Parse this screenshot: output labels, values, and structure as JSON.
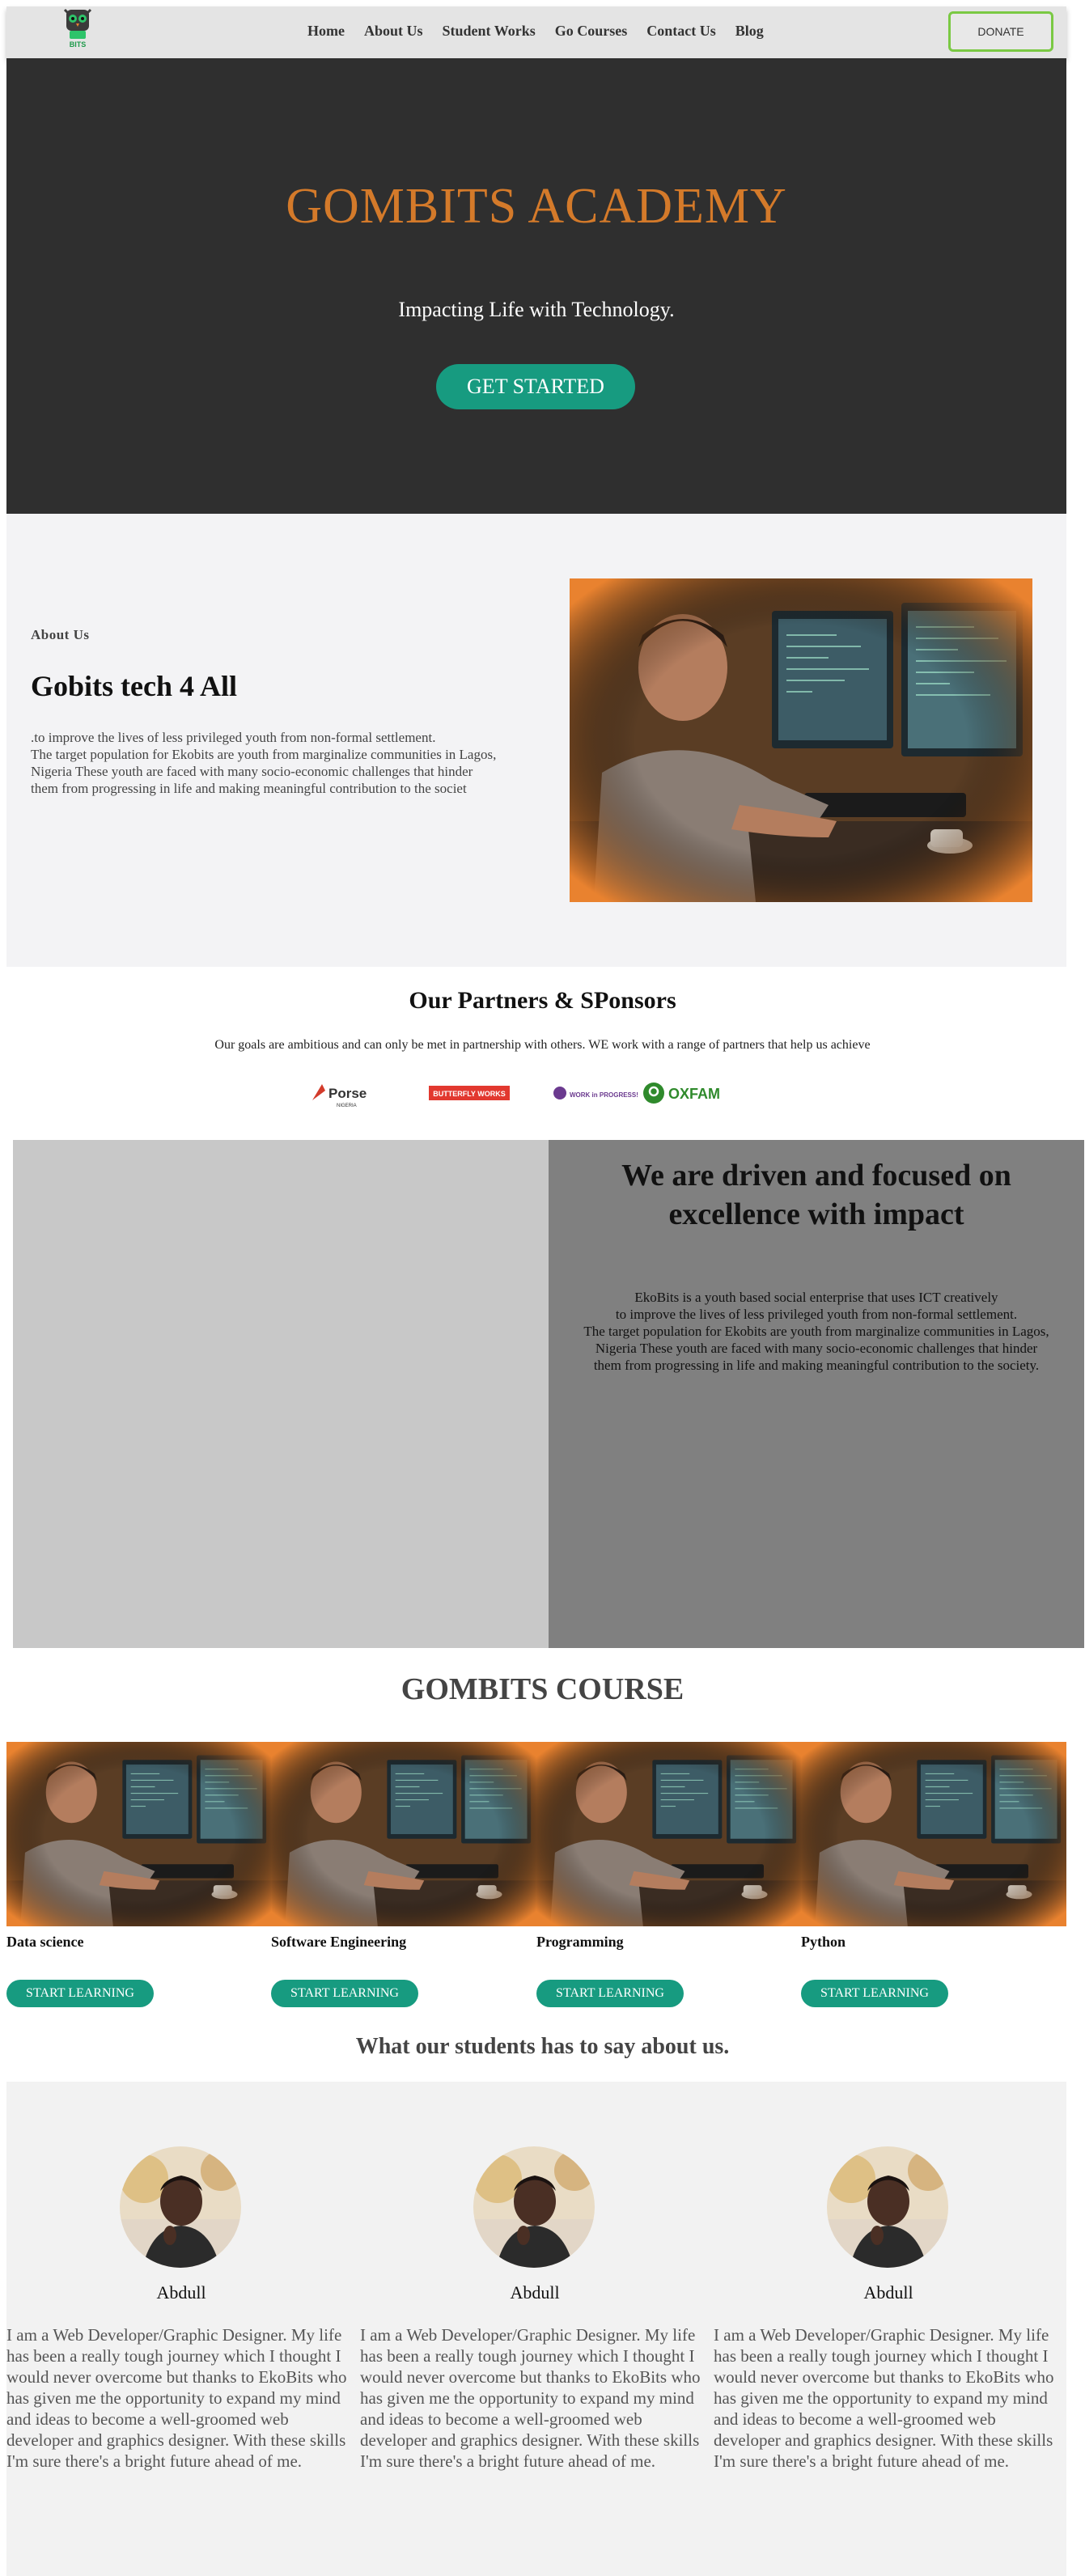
{
  "nav": {
    "logo_text": "BITS",
    "links": [
      "Home",
      "About Us",
      "Student Works",
      "Go Courses",
      "Contact Us",
      "Blog"
    ],
    "donate_label": "DONATE"
  },
  "hero": {
    "title": "GOMBITS ACADEMY",
    "tagline": "Impacting Life with Technology.",
    "cta": "GET STARTED"
  },
  "about": {
    "label": "About Us",
    "heading": "Gobits tech 4 All",
    "body": ".to improve the lives of less privileged youth from non-formal settlement.\nThe target population for Ekobits are youth from marginalize communities in Lagos,\nNigeria These youth are faced with many socio-economic challenges that hinder\nthem from progressing in life and making meaningful contribution to the societ"
  },
  "partners": {
    "heading": "Our Partners & SPonsors",
    "subtext": "Our goals are ambitious and can only be met in partnership with others. WE work with a range of partners that help us achieve",
    "logos": [
      {
        "name": "Porse",
        "sub": "NIGERIA",
        "color": "#d33b2b"
      },
      {
        "name": "BUTTERFLY WORKS",
        "color": "#e2382f"
      },
      {
        "name": "WORK in PROGRESS!",
        "color": "#6b3a8f"
      },
      {
        "name": "OXFAM",
        "color": "#2f8a2c"
      }
    ]
  },
  "driven": {
    "heading": "We are driven and focused on excellence with impact",
    "body": "EkoBits is a youth based social enterprise that uses ICT creatively\nto improve the lives of less privileged youth from non-formal settlement.\nThe target population for Ekobits are youth from marginalize communities in Lagos,\nNigeria These youth are faced with many socio-economic challenges that hinder\nthem from progressing in life and making meaningful contribution to the society."
  },
  "courses": {
    "title": "GOMBITS COURSE",
    "items": [
      {
        "name": "Data science",
        "cta": "START LEARNING"
      },
      {
        "name": "Software Engineering",
        "cta": "START LEARNING"
      },
      {
        "name": "Programming",
        "cta": "START LEARNING"
      },
      {
        "name": "Python",
        "cta": "START LEARNING"
      }
    ]
  },
  "testimonials": {
    "title": "What our students has to say about us.",
    "items": [
      {
        "name": "Abdull",
        "quote": "I am a Web Developer/Graphic Designer. My life has been a really tough journey which I thought I would never overcome but thanks to EkoBits who has given me the opportunity to expand my mind and ideas to become a well-groomed web developer and graphics designer. With these skills I'm sure there's a bright future ahead of me."
      },
      {
        "name": "Abdull",
        "quote": "I am a Web Developer/Graphic Designer. My life has been a really tough journey which I thought I would never overcome but thanks to EkoBits who has given me the opportunity to expand my mind and ideas to become a well-groomed web developer and graphics designer. With these skills I'm sure there's a bright future ahead of me."
      },
      {
        "name": "Abdull",
        "quote": "I am a Web Developer/Graphic Designer. My life has been a really tough journey which I thought I would never overcome but thanks to EkoBits who has given me the opportunity to expand my mind and ideas to become a well-groomed web developer and graphics designer. With these skills I'm sure there's a bright future ahead of me."
      }
    ]
  },
  "colors": {
    "accent_orange": "#d47a2a",
    "button_green": "#179b80",
    "donate_border": "#7ac943"
  }
}
